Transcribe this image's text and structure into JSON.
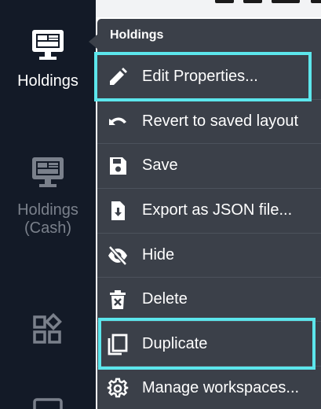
{
  "rail": {
    "items": [
      {
        "label": "Holdings",
        "icon": "monitor-dashboard-icon",
        "active": true
      },
      {
        "label": "Holdings\n(Cash)",
        "icon": "monitor-dashboard-icon",
        "active": false
      },
      {
        "label": "",
        "icon": "widgets-icon",
        "active": false
      },
      {
        "label": "",
        "icon": "monitor-icon",
        "active": false
      }
    ]
  },
  "menu": {
    "header": "Holdings",
    "items": [
      {
        "label": "Edit Properties...",
        "icon": "pencil-icon",
        "highlighted": true
      },
      {
        "label": "Revert to saved layout",
        "icon": "undo-icon",
        "highlighted": false
      },
      {
        "label": "Save",
        "icon": "floppy-disk-icon",
        "highlighted": false
      },
      {
        "label": "Export as JSON file...",
        "icon": "file-download-icon",
        "highlighted": false
      },
      {
        "label": "Hide",
        "icon": "eye-off-icon",
        "highlighted": false
      },
      {
        "label": "Delete",
        "icon": "trash-icon",
        "highlighted": false
      },
      {
        "label": "Duplicate",
        "icon": "copy-icon",
        "highlighted": true
      },
      {
        "label": "Manage workspaces...",
        "icon": "gear-icon",
        "highlighted": false
      }
    ]
  },
  "colors": {
    "rail_bg": "#131a27",
    "menu_bg": "#3b4049",
    "highlight": "#5ce6ec",
    "text": "#ffffff",
    "dim_text": "#7a808b"
  }
}
